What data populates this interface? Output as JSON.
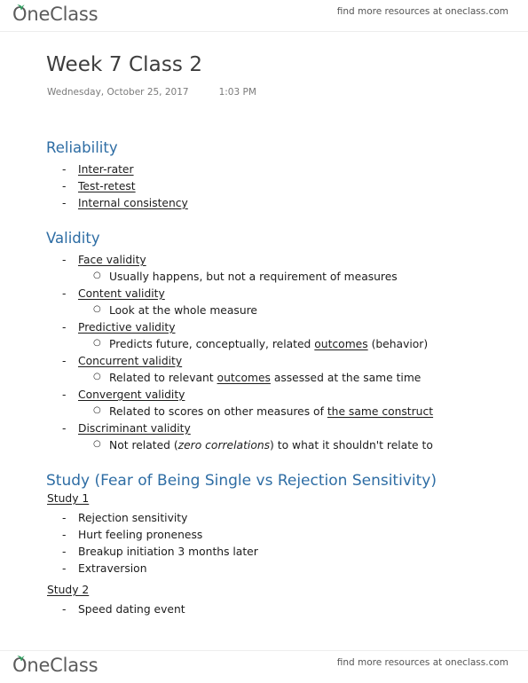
{
  "header": {
    "brand": "OneClass",
    "leaf_icon": "leaf-icon",
    "tagline": "find more resources at oneclass.com",
    "brand_color": "#5b5b5b",
    "leaf_color": "#2f9e5f"
  },
  "footer": {
    "brand": "OneClass",
    "tagline": "find more resources at oneclass.com"
  },
  "title": {
    "text": "Week 7 Class 2",
    "date": "Wednesday, October 25, 2017",
    "time": "1:03 PM"
  },
  "accent_color": "#2e6da4",
  "sections": [
    {
      "heading": "Reliability",
      "items": [
        {
          "marker": "-",
          "text": "Inter-rater"
        },
        {
          "marker": "-",
          "text": "Test-retest"
        },
        {
          "marker": "-",
          "text": "Internal consistency"
        }
      ]
    },
    {
      "heading": "Validity",
      "items": [
        {
          "marker": "-",
          "text": "Face validity"
        },
        {
          "marker": "o",
          "text": "Usually happens, but not a requirement of measures"
        },
        {
          "marker": "-",
          "text": "Content validity"
        },
        {
          "marker": "o",
          "text": "Look at the whole measure"
        },
        {
          "marker": "-",
          "text": "Predictive validity"
        },
        {
          "marker": "o",
          "pre": "Predicts future, conceptually, related ",
          "em": "outcomes",
          "post": " (behavior)"
        },
        {
          "marker": "-",
          "text": "Concurrent validity"
        },
        {
          "marker": "o",
          "pre": "Related to relevant ",
          "em": "outcomes",
          "post": " assessed at the same time"
        },
        {
          "marker": "-",
          "text": "Convergent validity"
        },
        {
          "marker": "o",
          "pre": "Related to scores on other measures of ",
          "em": "the same construct",
          "post": ""
        },
        {
          "marker": "-",
          "text": "Discriminant validity"
        },
        {
          "marker": "o",
          "pre": "Not related (",
          "it": "zero correlations",
          "post": ") to what it shouldn't relate to"
        }
      ]
    },
    {
      "heading": "Study (Fear of Being Single vs Rejection Sensitivity)",
      "subsections": [
        {
          "label": "Study 1",
          "items": [
            {
              "marker": "-",
              "text": "Rejection sensitivity"
            },
            {
              "marker": "-",
              "text": "Hurt feeling proneness"
            },
            {
              "marker": "-",
              "text": "Breakup initiation 3 months later"
            },
            {
              "marker": "-",
              "text": "Extraversion"
            }
          ]
        },
        {
          "label": "Study 2",
          "items": [
            {
              "marker": "-",
              "text": "Speed dating event"
            }
          ]
        }
      ]
    }
  ]
}
